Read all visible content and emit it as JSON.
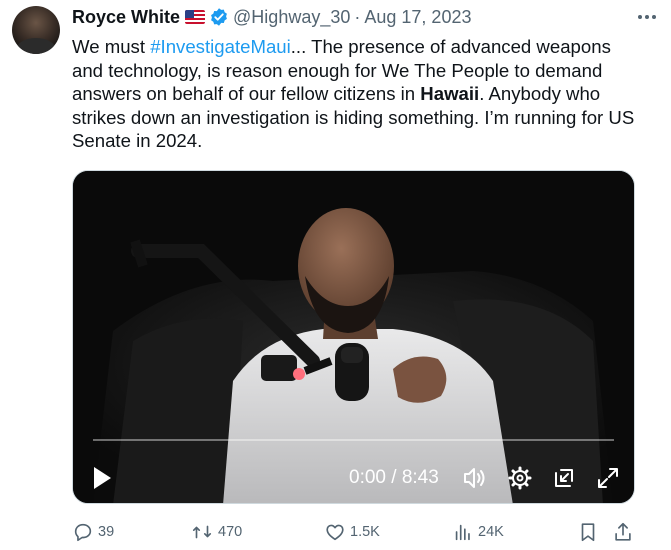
{
  "author": {
    "name": "Royce White",
    "flag_icon": "us-flag-icon",
    "verified": true,
    "handle": "@Highway_30",
    "separator": "·",
    "date": "Aug 17, 2023"
  },
  "tweet": {
    "text_before_hashtag": "We must ",
    "hashtag": "#InvestigateMaui",
    "text_after_hashtag": "... The presence of advanced weapons and technology, is reason enough for We The People to demand answers on behalf of our fellow citizens in ",
    "bold_word": "Hawaii",
    "text_end": ". Anybody who strikes down an investigation is hiding something. I’m running for US Senate in 2024."
  },
  "video": {
    "time_display": "0:00 / 8:43",
    "progress": 0,
    "icons": [
      "play-icon",
      "volume-icon",
      "settings-icon",
      "picture-in-picture-icon",
      "fullscreen-icon"
    ]
  },
  "actions": {
    "replies": "39",
    "reposts": "470",
    "likes": "1.5K",
    "views": "24K"
  },
  "colors": {
    "link": "#1d9bf0",
    "muted": "#536471",
    "text": "#0f1419",
    "verified": "#1d9bf0"
  }
}
